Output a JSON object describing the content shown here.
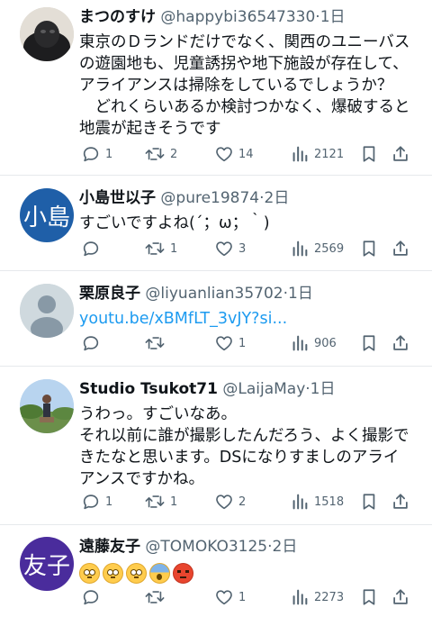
{
  "posts": [
    {
      "name": "まつのすけ",
      "handle": "@happybi36547330",
      "sep": "·",
      "time": "1日",
      "avatar_text": "",
      "lines": [
        "東京のＤランドだけでなく、関西のユニーバス",
        "の遊園地も、児童誘拐や地下施設が存在して、",
        "アライアンスは掃除をしているでしょうか？",
        "　どれくらいあるか検討つかなく、爆破すると",
        "地震が起きそうです"
      ],
      "replies": "1",
      "reposts": "2",
      "likes": "14",
      "views": "2121"
    },
    {
      "name": "小島世以子",
      "handle": "@pure19874",
      "sep": "·",
      "time": "2日",
      "avatar_text": "小島",
      "lines": [
        "すごいですよね(´；ω；｀)"
      ],
      "replies": "",
      "reposts": "1",
      "likes": "3",
      "views": "2569"
    },
    {
      "name": "栗原良子",
      "handle": "@liyuanlian35702",
      "sep": "·",
      "time": "1日",
      "avatar_text": "",
      "link": "youtu.be/xBMfLT_3vJY?si...",
      "replies": "",
      "reposts": "",
      "likes": "1",
      "views": "906"
    },
    {
      "name": "Studio Tsukot71",
      "handle": "@LaijaMay",
      "sep": "·",
      "time": "1日",
      "avatar_text": "",
      "lines": [
        "うわっ。すごいなあ。",
        "それ以前に誰が撮影したんだろう、よく撮影で",
        "きたなと思います。DSになりすましのアライ",
        "アンスですかね。"
      ],
      "replies": "1",
      "reposts": "1",
      "likes": "2",
      "views": "1518"
    },
    {
      "name": "遠藤友子",
      "handle": "@TOMOKO3125",
      "sep": "·",
      "time": "2日",
      "avatar_text": "友子",
      "emojis": [
        "flushed-face",
        "flushed-face",
        "flushed-face",
        "screaming-face",
        "angry-face"
      ],
      "replies": "",
      "reposts": "",
      "likes": "1",
      "views": "2273"
    }
  ],
  "colors": {
    "text": "#0f1419",
    "secondary": "#536471",
    "link": "#1d9bf0",
    "avatar_blue": "#1f5fa8",
    "avatar_purple": "#4a2c9c",
    "avatar_gray": "#cfd9de"
  },
  "icons": [
    "reply-icon",
    "repost-icon",
    "like-icon",
    "views-icon",
    "bookmark-icon",
    "share-icon"
  ]
}
